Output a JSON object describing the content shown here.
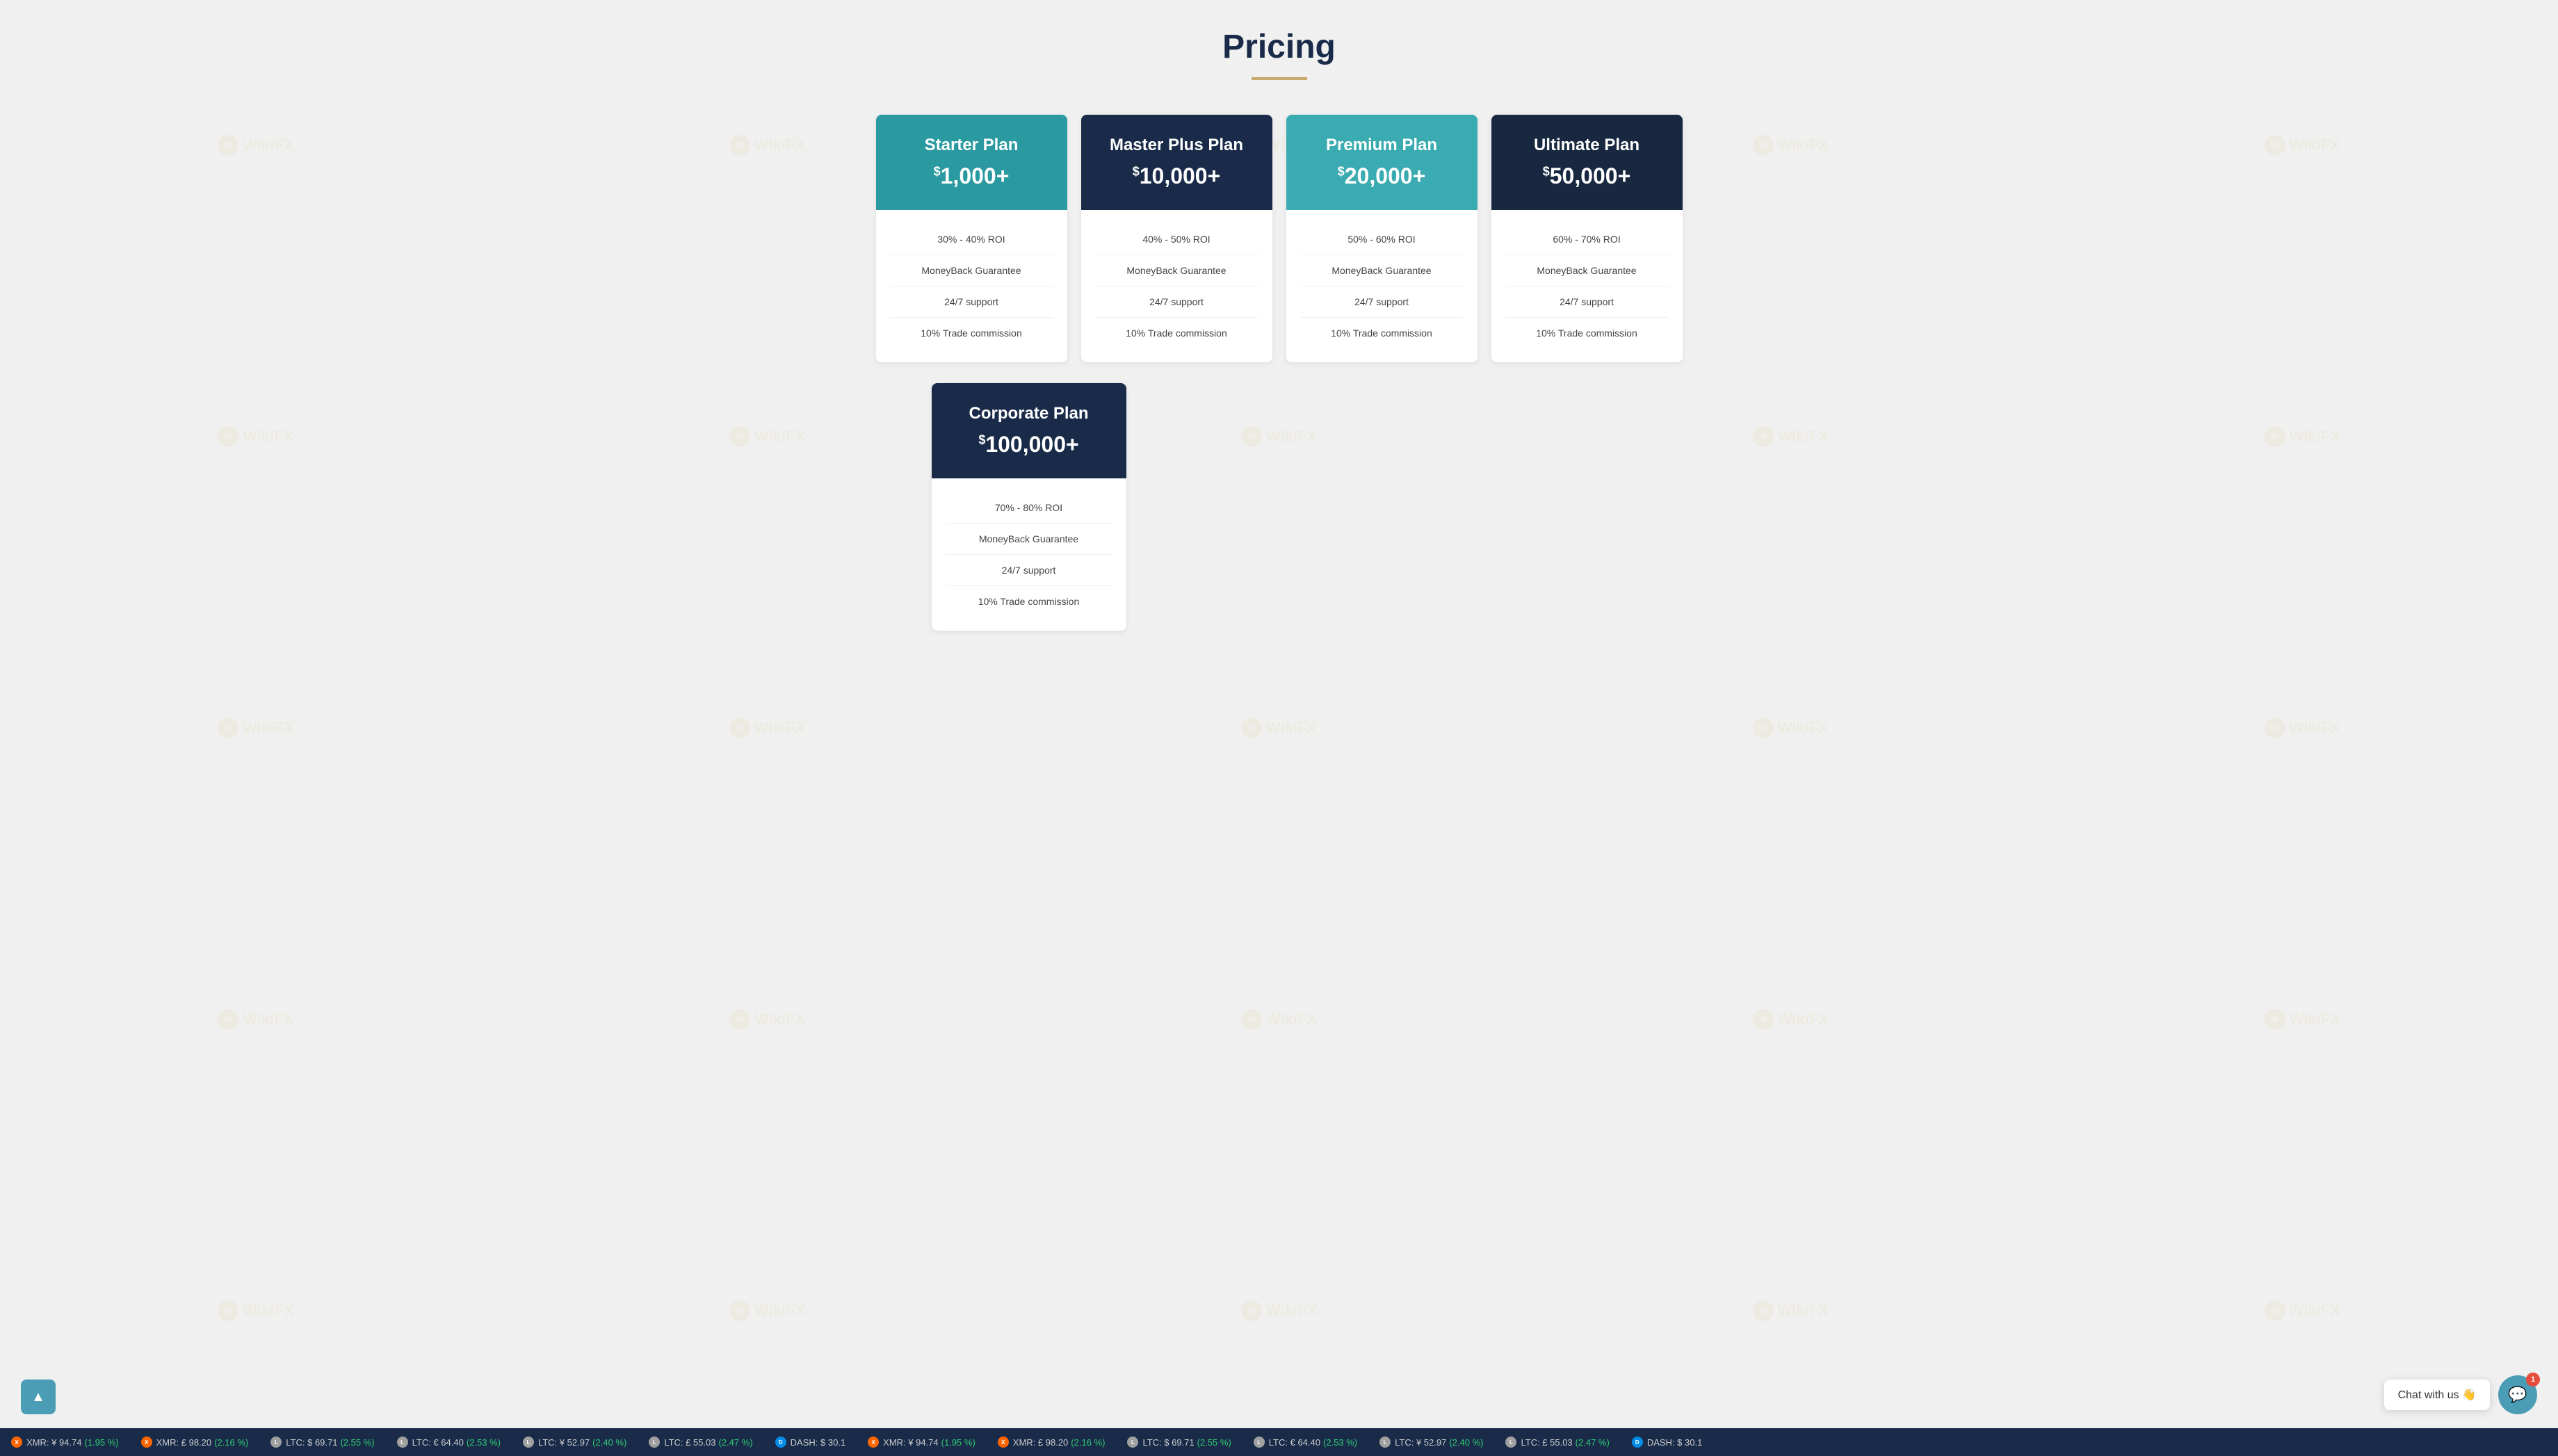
{
  "page": {
    "title": "Pricing",
    "title_underline_color": "#c8a96e"
  },
  "plans": [
    {
      "name": "Starter Plan",
      "currency": "$",
      "price": "1,000+",
      "header_class": "teal",
      "roi": "30% - 40% ROI",
      "features": [
        "MoneyBack Guarantee",
        "24/7 support",
        "10% Trade commission"
      ]
    },
    {
      "name": "Master Plus Plan",
      "currency": "$",
      "price": "10,000+",
      "header_class": "dark-navy",
      "roi": "40% - 50% ROI",
      "features": [
        "MoneyBack Guarantee",
        "24/7 support",
        "10% Trade commission"
      ]
    },
    {
      "name": "Premium Plan",
      "currency": "$",
      "price": "20,000+",
      "header_class": "teal2",
      "roi": "50% - 60% ROI",
      "features": [
        "MoneyBack Guarantee",
        "24/7 support",
        "10% Trade commission"
      ]
    },
    {
      "name": "Ultimate Plan",
      "currency": "$",
      "price": "50,000+",
      "header_class": "dark-navy2",
      "roi": "60% - 70% ROI",
      "features": [
        "MoneyBack Guarantee",
        "24/7 support",
        "10% Trade commission"
      ]
    }
  ],
  "corporate_plan": {
    "name": "Corporate Plan",
    "currency": "$",
    "price": "100,000+",
    "roi": "70% - 80% ROI",
    "features": [
      "MoneyBack Guarantee",
      "24/7 support",
      "10% Trade commission"
    ]
  },
  "chat": {
    "label": "Chat with us 👋",
    "badge": "1"
  },
  "scroll_top": {
    "icon": "▲"
  },
  "ticker": {
    "items": [
      {
        "coin": "XMR",
        "currency": "¥",
        "price": "94.74",
        "change": "1.95 %",
        "positive": true,
        "icon_class": "coin-xmr"
      },
      {
        "coin": "XMR",
        "currency": "£",
        "price": "98.20",
        "change": "2.16 %",
        "positive": true,
        "icon_class": "coin-xmr"
      },
      {
        "coin": "LTC",
        "currency": "$",
        "price": "69.71",
        "change": "2.55 %",
        "positive": true,
        "icon_class": "coin-ltc"
      },
      {
        "coin": "LTC",
        "currency": "€",
        "price": "64.40",
        "change": "2.53 %",
        "positive": true,
        "icon_class": "coin-ltc"
      },
      {
        "coin": "LTC",
        "currency": "¥",
        "price": "52.97",
        "change": "2.40 %",
        "positive": true,
        "icon_class": "coin-ltc"
      },
      {
        "coin": "LTC",
        "currency": "£",
        "price": "55.03",
        "change": "2.47 %",
        "positive": true,
        "icon_class": "coin-ltc"
      },
      {
        "coin": "DASH",
        "currency": "$",
        "price": "30.1",
        "change": "",
        "positive": true,
        "icon_class": "coin-dash"
      }
    ]
  },
  "watermark": {
    "text": "WikiFX"
  }
}
